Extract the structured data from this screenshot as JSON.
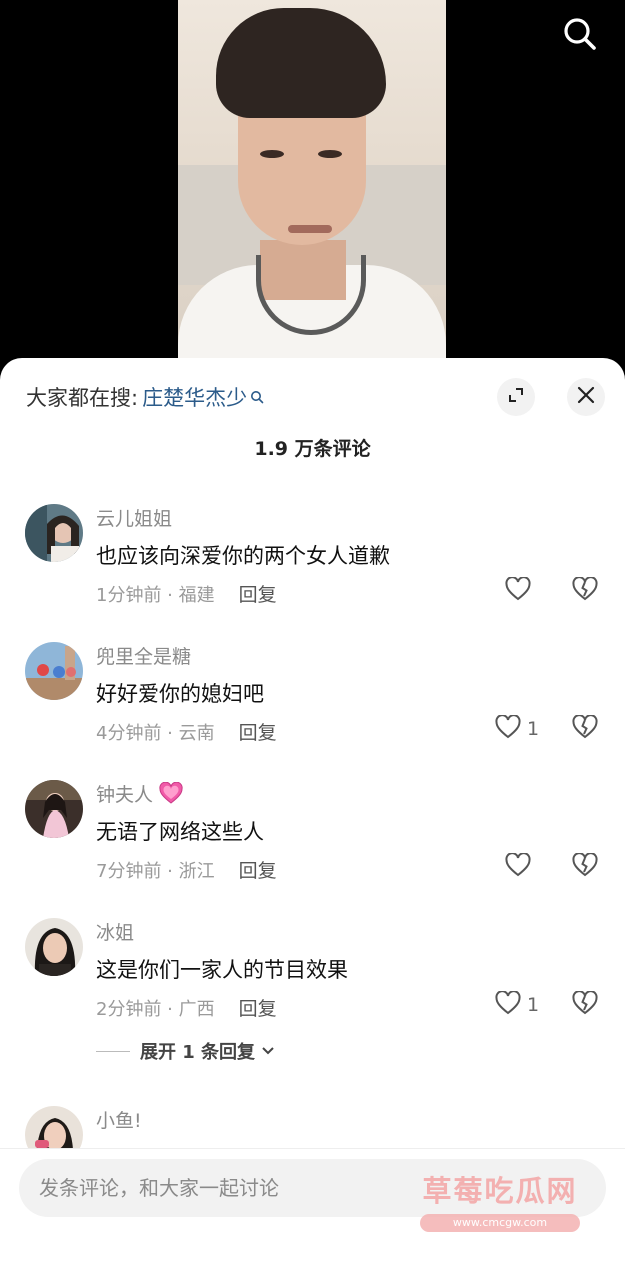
{
  "hot_search": {
    "prefix": "大家都在搜:",
    "term": "庄楚华杰少"
  },
  "comment_count": "1.9 万条评论",
  "comments": [
    {
      "user": "云儿姐姐",
      "text": "也应该向深爱你的两个女人道歉",
      "time_location": "1分钟前 · 福建",
      "reply": "回复",
      "likes": "",
      "badge": ""
    },
    {
      "user": "兜里全是糖",
      "text": "好好爱你的媳妇吧",
      "time_location": "4分钟前 · 云南",
      "reply": "回复",
      "likes": "1",
      "badge": ""
    },
    {
      "user": "钟夫人",
      "text": "无语了网络这些人",
      "time_location": "7分钟前 · 浙江",
      "reply": "回复",
      "likes": "",
      "badge": "pink-heart-icon"
    },
    {
      "user": "冰姐",
      "text": "这是你们一家人的节目效果",
      "time_location": "2分钟前 · 广西",
      "reply": "回复",
      "likes": "1",
      "badge": ""
    },
    {
      "user": "小鱼!",
      "text": "",
      "time_location": "",
      "reply": "",
      "likes": "",
      "badge": ""
    }
  ],
  "expand_replies": "展开 1 条回复",
  "input": {
    "placeholder": "发条评论，和大家一起讨论"
  },
  "watermark": {
    "main": "草莓吃瓜网",
    "url": "www.cmcgw.com"
  },
  "colors": {
    "link": "#2b5b8a",
    "sheet_bg": "#ffffff",
    "video_bg": "#000000"
  }
}
